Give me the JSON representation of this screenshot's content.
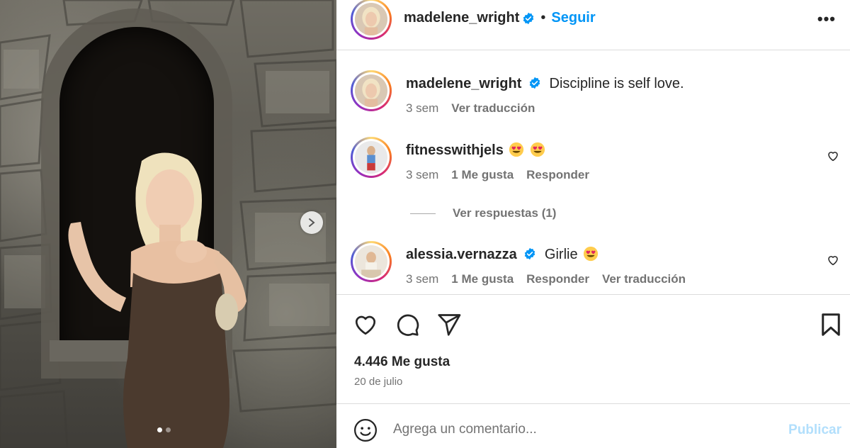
{
  "post": {
    "author": "madelene_wright",
    "follow_label": "Seguir",
    "bullet": "•",
    "more_label": "•••",
    "slide_count": 2,
    "active_slide": 1
  },
  "comments": [
    {
      "username": "madelene_wright",
      "verified": true,
      "text": "Discipline is self love.",
      "time": "3 sem",
      "translate": "Ver traducción"
    },
    {
      "username": "fitnesswithjels",
      "verified": false,
      "emojis": [
        "heart-eyes-emoji",
        "heart-eyes-emoji"
      ],
      "time": "3 sem",
      "likes": "1 Me gusta",
      "reply": "Responder",
      "view_replies": "Ver respuestas (1)"
    },
    {
      "username": "alessia.vernazza",
      "verified": true,
      "text": "Girlie",
      "emojis": [
        "heart-eyes-emoji"
      ],
      "time": "3 sem",
      "likes": "1 Me gusta",
      "reply": "Responder",
      "translate": "Ver traducción"
    }
  ],
  "stats": {
    "likes": "4.446 Me gusta",
    "date": "20 de julio"
  },
  "composer": {
    "placeholder": "Agrega un comentario...",
    "publish_label": "Publicar"
  },
  "colors": {
    "accent": "#0095f6",
    "publish_disabled": "#b2dffc",
    "verified": "#0095f6",
    "muted_text": "#737373"
  },
  "icons": [
    "verified-badge-icon",
    "heart-icon",
    "comment-icon",
    "share-icon",
    "bookmark-icon",
    "emoji-icon",
    "chevron-right-icon",
    "more-icon"
  ]
}
